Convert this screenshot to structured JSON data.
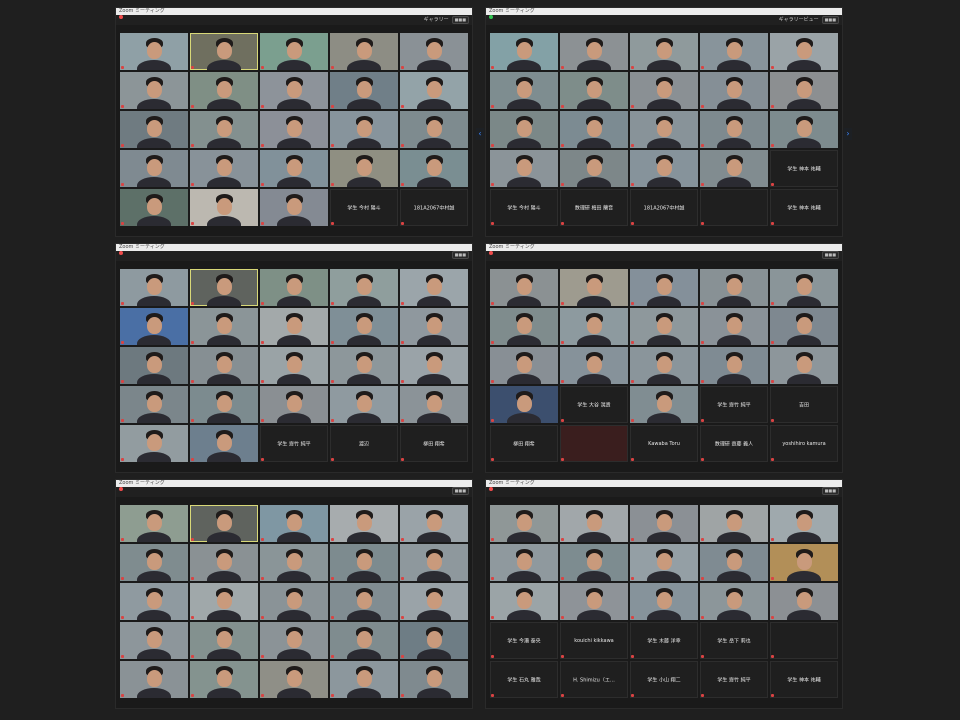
{
  "windows": [
    {
      "title": "Zoom ミーティング",
      "toolbar": {
        "right_label": "ギャラリー",
        "view_label": "■■■"
      },
      "tiles": [
        {
          "label": "",
          "color": "#8fa0a6",
          "type": "person"
        },
        {
          "label": "",
          "color": "#6f6f5f",
          "type": "active-person"
        },
        {
          "label": "",
          "color": "#7b9f8f",
          "type": "person"
        },
        {
          "label": "",
          "color": "#8d8d84",
          "type": "person"
        },
        {
          "label": "",
          "color": "#8a9196",
          "type": "person"
        },
        {
          "label": "",
          "color": "#8c9598",
          "type": "person"
        },
        {
          "label": "",
          "color": "#7f8f85",
          "type": "person"
        },
        {
          "label": "",
          "color": "#8d939a",
          "type": "person"
        },
        {
          "label": "",
          "color": "#707f88",
          "type": "person"
        },
        {
          "label": "",
          "color": "#93a3a8",
          "type": "person"
        },
        {
          "label": "",
          "color": "#6f7b81",
          "type": "person"
        },
        {
          "label": "",
          "color": "#83908f",
          "type": "person"
        },
        {
          "label": "",
          "color": "#8c9098",
          "type": "person"
        },
        {
          "label": "",
          "color": "#87949c",
          "type": "person"
        },
        {
          "label": "",
          "color": "#7e8b8f",
          "type": "person"
        },
        {
          "label": "",
          "color": "#7f8a91",
          "type": "person"
        },
        {
          "label": "",
          "color": "#889299",
          "type": "person"
        },
        {
          "label": "",
          "color": "#81919a",
          "type": "person"
        },
        {
          "label": "",
          "color": "#8f8f82",
          "type": "person"
        },
        {
          "label": "",
          "color": "#7a8e92",
          "type": "person"
        },
        {
          "label": "",
          "color": "#5d7068",
          "type": "person"
        },
        {
          "label": "",
          "color": "#bcb8b0",
          "type": "person"
        },
        {
          "label": "",
          "color": "#848a93",
          "type": "person"
        },
        {
          "label": "学生 今村 陽斗",
          "color": "#1f1f1f",
          "type": "name"
        },
        {
          "label": "181A2067中村誠",
          "color": "#1f1f1f",
          "type": "name"
        }
      ]
    },
    {
      "title": "Zoom ミーティング",
      "toolbar": {
        "right_label": "ギャラリービュー",
        "view_label": "■■■"
      },
      "tiles": [
        {
          "label": "",
          "color": "#83a1a6",
          "type": "person"
        },
        {
          "label": "",
          "color": "#8c9194",
          "type": "person"
        },
        {
          "label": "",
          "color": "#8f9a9c",
          "type": "person"
        },
        {
          "label": "",
          "color": "#88949b",
          "type": "person"
        },
        {
          "label": "",
          "color": "#9aa3a7",
          "type": "person"
        },
        {
          "label": "",
          "color": "#7e8d90",
          "type": "person"
        },
        {
          "label": "",
          "color": "#7e8d8a",
          "type": "person"
        },
        {
          "label": "",
          "color": "#8a9094",
          "type": "person"
        },
        {
          "label": "",
          "color": "#858f96",
          "type": "person"
        },
        {
          "label": "",
          "color": "#8c8f91",
          "type": "person"
        },
        {
          "label": "",
          "color": "#7b8888",
          "type": "person"
        },
        {
          "label": "",
          "color": "#7c8b92",
          "type": "person"
        },
        {
          "label": "",
          "color": "#889399",
          "type": "person"
        },
        {
          "label": "",
          "color": "#7e8a8f",
          "type": "person"
        },
        {
          "label": "",
          "color": "#7d8b8e",
          "type": "person"
        },
        {
          "label": "",
          "color": "#8b9499",
          "type": "person"
        },
        {
          "label": "",
          "color": "#7d8789",
          "type": "person"
        },
        {
          "label": "",
          "color": "#86939b",
          "type": "person"
        },
        {
          "label": "",
          "color": "#818c90",
          "type": "person"
        },
        {
          "label": "学生 神本 祐輔",
          "color": "#1f1f1f",
          "type": "name"
        },
        {
          "label": "学生 今村 陽斗",
          "color": "#1f1f1f",
          "type": "name"
        },
        {
          "label": "数理研 梅田 蘭音",
          "color": "#1f1f1f",
          "type": "name"
        },
        {
          "label": "181A2067中村誠",
          "color": "#1f1f1f",
          "type": "name"
        },
        {
          "label": "",
          "color": "#1f1f1f",
          "type": "name"
        },
        {
          "label": "学生 神本 祐輔",
          "color": "#1f1f1f",
          "type": "name"
        }
      ]
    },
    {
      "title": "Zoom ミーティング",
      "toolbar": {
        "right_label": "",
        "view_label": "■■■"
      },
      "tiles": [
        {
          "label": "",
          "color": "#8e9aa0",
          "type": "person"
        },
        {
          "label": "",
          "color": "#5f635e",
          "type": "active-person"
        },
        {
          "label": "",
          "color": "#7e9086",
          "type": "person"
        },
        {
          "label": "",
          "color": "#8f9e9d",
          "type": "person"
        },
        {
          "label": "",
          "color": "#9ba5aa",
          "type": "person"
        },
        {
          "label": "",
          "color": "#4a6fa5",
          "type": "person"
        },
        {
          "label": "",
          "color": "#8b9598",
          "type": "person"
        },
        {
          "label": "",
          "color": "#a3a9aa",
          "type": "person"
        },
        {
          "label": "",
          "color": "#7f8f97",
          "type": "person"
        },
        {
          "label": "",
          "color": "#8f989e",
          "type": "person"
        },
        {
          "label": "",
          "color": "#6d797f",
          "type": "person"
        },
        {
          "label": "",
          "color": "#868f93",
          "type": "person"
        },
        {
          "label": "",
          "color": "#9aa3a6",
          "type": "person"
        },
        {
          "label": "",
          "color": "#8d979b",
          "type": "person"
        },
        {
          "label": "",
          "color": "#9aa3a8",
          "type": "person"
        },
        {
          "label": "",
          "color": "#7b868b",
          "type": "person"
        },
        {
          "label": "",
          "color": "#7c8b8f",
          "type": "person"
        },
        {
          "label": "",
          "color": "#8a8f93",
          "type": "person"
        },
        {
          "label": "",
          "color": "#8f9aa0",
          "type": "person"
        },
        {
          "label": "",
          "color": "#8b9398",
          "type": "person"
        },
        {
          "label": "",
          "color": "#929ca0",
          "type": "person"
        },
        {
          "label": "",
          "color": "#6d7f8e",
          "type": "person"
        },
        {
          "label": "学生 齋竹 純平",
          "color": "#1f1f1f",
          "type": "name"
        },
        {
          "label": "渡辺",
          "color": "#1f1f1f",
          "type": "name"
        },
        {
          "label": "柳田 翔希",
          "color": "#1f1f1f",
          "type": "name"
        }
      ]
    },
    {
      "title": "Zoom ミーティング",
      "toolbar": {
        "right_label": "",
        "view_label": "■■■"
      },
      "tiles": [
        {
          "label": "",
          "color": "#8b9193",
          "type": "person"
        },
        {
          "label": "",
          "color": "#9e9b8f",
          "type": "person"
        },
        {
          "label": "",
          "color": "#84909a",
          "type": "person"
        },
        {
          "label": "",
          "color": "#889195",
          "type": "person"
        },
        {
          "label": "",
          "color": "#8a9599",
          "type": "person"
        },
        {
          "label": "",
          "color": "#7f8c8d",
          "type": "person"
        },
        {
          "label": "",
          "color": "#8d9a9f",
          "type": "person"
        },
        {
          "label": "",
          "color": "#8e989c",
          "type": "person"
        },
        {
          "label": "",
          "color": "#8a9298",
          "type": "person"
        },
        {
          "label": "",
          "color": "#7e8890",
          "type": "person"
        },
        {
          "label": "",
          "color": "#888f95",
          "type": "person"
        },
        {
          "label": "",
          "color": "#86929a",
          "type": "person"
        },
        {
          "label": "",
          "color": "#8a959b",
          "type": "person"
        },
        {
          "label": "",
          "color": "#7f8b93",
          "type": "person"
        },
        {
          "label": "",
          "color": "#8d969b",
          "type": "person"
        },
        {
          "label": "",
          "color": "#3c4f6e",
          "type": "person"
        },
        {
          "label": "学生 大谷 滉貴",
          "color": "#1f1f1f",
          "type": "name"
        },
        {
          "label": "",
          "color": "#808d92",
          "type": "person"
        },
        {
          "label": "学生 齋竹 純平",
          "color": "#1f1f1f",
          "type": "name"
        },
        {
          "label": "吉田",
          "color": "#1f1f1f",
          "type": "name"
        },
        {
          "label": "柳田 翔希",
          "color": "#1f1f1f",
          "type": "name"
        },
        {
          "label": "",
          "color": "#3a1e1e",
          "type": "name"
        },
        {
          "label": "Kawaba Toru",
          "color": "#1f1f1f",
          "type": "name"
        },
        {
          "label": "数理研 齋藤 義人",
          "color": "#1f1f1f",
          "type": "name"
        },
        {
          "label": "yoshihiro kamura",
          "color": "#1f1f1f",
          "type": "name"
        }
      ]
    },
    {
      "title": "Zoom ミーティング",
      "toolbar": {
        "right_label": "",
        "view_label": "■■■"
      },
      "tiles": [
        {
          "label": "",
          "color": "#8e9d91",
          "type": "person"
        },
        {
          "label": "",
          "color": "#5f635e",
          "type": "active-person"
        },
        {
          "label": "",
          "color": "#7f97a3",
          "type": "person"
        },
        {
          "label": "",
          "color": "#a7acae",
          "type": "person"
        },
        {
          "label": "",
          "color": "#9aa3a8",
          "type": "person"
        },
        {
          "label": "",
          "color": "#7f8c8f",
          "type": "person"
        },
        {
          "label": "",
          "color": "#8a9194",
          "type": "person"
        },
        {
          "label": "",
          "color": "#8a9598",
          "type": "person"
        },
        {
          "label": "",
          "color": "#7d8b8f",
          "type": "person"
        },
        {
          "label": "",
          "color": "#8e989d",
          "type": "person"
        },
        {
          "label": "",
          "color": "#8f9aa0",
          "type": "person"
        },
        {
          "label": "",
          "color": "#a0a8aa",
          "type": "person"
        },
        {
          "label": "",
          "color": "#8a9397",
          "type": "person"
        },
        {
          "label": "",
          "color": "#818d92",
          "type": "person"
        },
        {
          "label": "",
          "color": "#9aa3a8",
          "type": "person"
        },
        {
          "label": "",
          "color": "#8d969b",
          "type": "person"
        },
        {
          "label": "",
          "color": "#83918f",
          "type": "person"
        },
        {
          "label": "",
          "color": "#8b9397",
          "type": "person"
        },
        {
          "label": "",
          "color": "#7f8c8f",
          "type": "person"
        },
        {
          "label": "",
          "color": "#6e7d85",
          "type": "person"
        },
        {
          "label": "",
          "color": "#8a9296",
          "type": "person"
        },
        {
          "label": "",
          "color": "#84938f",
          "type": "person"
        },
        {
          "label": "",
          "color": "#8f8f87",
          "type": "person"
        },
        {
          "label": "",
          "color": "#8c979d",
          "type": "person"
        },
        {
          "label": "",
          "color": "#7f8a8f",
          "type": "person"
        }
      ]
    },
    {
      "title": "Zoom ミーティング",
      "toolbar": {
        "right_label": "",
        "view_label": "■■■"
      },
      "tiles": [
        {
          "label": "",
          "color": "#8f9797",
          "type": "person"
        },
        {
          "label": "",
          "color": "#a1a7aa",
          "type": "person"
        },
        {
          "label": "",
          "color": "#8b9095",
          "type": "person"
        },
        {
          "label": "",
          "color": "#9fa4a5",
          "type": "person"
        },
        {
          "label": "",
          "color": "#9fa9ad",
          "type": "person"
        },
        {
          "label": "",
          "color": "#8f999e",
          "type": "person"
        },
        {
          "label": "",
          "color": "#7d8c90",
          "type": "person"
        },
        {
          "label": "",
          "color": "#949fa5",
          "type": "person"
        },
        {
          "label": "",
          "color": "#7f8b92",
          "type": "person"
        },
        {
          "label": "",
          "color": "#b28f58",
          "type": "person"
        },
        {
          "label": "",
          "color": "#9ba4a7",
          "type": "person"
        },
        {
          "label": "",
          "color": "#8e9398",
          "type": "person"
        },
        {
          "label": "",
          "color": "#86939b",
          "type": "person"
        },
        {
          "label": "",
          "color": "#8c969a",
          "type": "person"
        },
        {
          "label": "",
          "color": "#8c9094",
          "type": "person"
        },
        {
          "label": "学生 今瀬 泰央",
          "color": "#1f1f1f",
          "type": "name"
        },
        {
          "label": "kouichi kikkawa",
          "color": "#1f1f1f",
          "type": "name"
        },
        {
          "label": "学生 木藤 洋幸",
          "color": "#1f1f1f",
          "type": "name"
        },
        {
          "label": "学生 岳下 莉也",
          "color": "#1f1f1f",
          "type": "name"
        },
        {
          "label": "",
          "color": "#1f1f1f",
          "type": "name"
        },
        {
          "label": "学生 石丸 雅哉",
          "color": "#1f1f1f",
          "type": "name"
        },
        {
          "label": "H. Shimizu（エ…",
          "color": "#1f1f1f",
          "type": "name"
        },
        {
          "label": "学生 小山 翔二",
          "color": "#1f1f1f",
          "type": "name"
        },
        {
          "label": "学生 齋竹 純平",
          "color": "#1f1f1f",
          "type": "name"
        },
        {
          "label": "学生 神本 祐輔",
          "color": "#1f1f1f",
          "type": "name"
        }
      ]
    }
  ]
}
